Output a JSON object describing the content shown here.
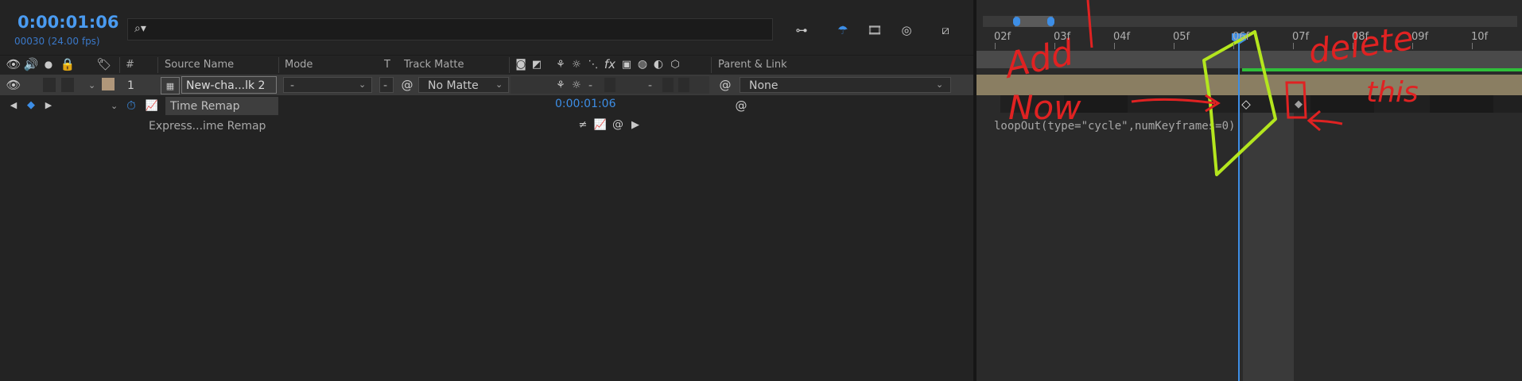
{
  "timecode": "0:00:01:06",
  "frame_info": "00030 (24.00 fps)",
  "search": {
    "placeholder": ""
  },
  "columns": {
    "hash": "#",
    "source_name": "Source Name",
    "mode": "Mode",
    "t": "T",
    "track_matte": "Track Matte",
    "parent_link": "Parent & Link"
  },
  "layer": {
    "number": "1",
    "name": "New-cha...lk 2",
    "mode": "-",
    "matte_dash": "-",
    "track_matte": "No Matte",
    "parent": "None"
  },
  "property": {
    "name": "Time Remap",
    "value": "0:00:01:06"
  },
  "expression": {
    "label": "Express...ime Remap",
    "code": "loopOut(type=\"cycle\",numKeyframes=0)"
  },
  "ruler": {
    "ticks": [
      "02f",
      "03f",
      "04f",
      "05f",
      "06f",
      "07f",
      "08f",
      "09f",
      "10f"
    ]
  },
  "annotations": {
    "add_now": [
      "Add",
      "Now"
    ],
    "delete_this": [
      "delete",
      "this"
    ]
  },
  "colors": {
    "accent_blue": "#3d8ee6",
    "layer_bar": "#8a7e62",
    "work_area_green": "#2fbf3a",
    "annotation_red": "#e02222",
    "annotation_green": "#b4e61e"
  }
}
